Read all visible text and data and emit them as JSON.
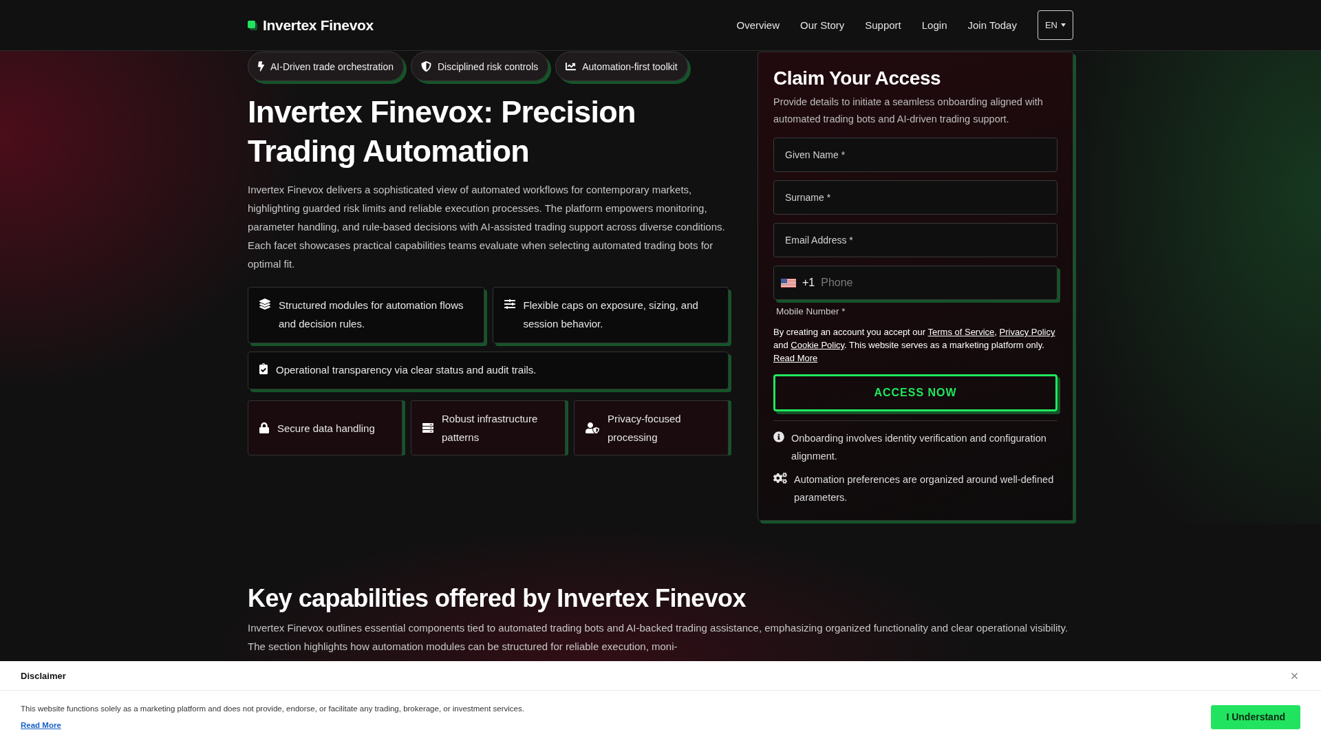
{
  "header": {
    "logo": "Invertex Finevox",
    "nav": [
      {
        "label": "Overview"
      },
      {
        "label": "Our Story"
      },
      {
        "label": "Support"
      },
      {
        "label": "Login"
      },
      {
        "label": "Join Today"
      }
    ],
    "language": "EN"
  },
  "hero": {
    "badges": [
      {
        "label": "AI-Driven trade orchestration"
      },
      {
        "label": "Disciplined risk controls"
      },
      {
        "label": "Automation-first toolkit"
      }
    ],
    "title": "Invertex Finevox: Precision Trading Automation",
    "description": "Invertex Finevox delivers a sophisticated view of automated workflows for contemporary markets, highlighting guarded risk limits and reliable execution processes. The platform empowers monitoring, parameter handling, and rule-based decisions with AI-assisted trading support across diverse conditions. Each facet showcases practical capabilities teams evaluate when selecting automated trading bots for optimal fit.",
    "features": [
      {
        "text": "Structured modules for automation flows and decision rules."
      },
      {
        "text": "Flexible caps on exposure, sizing, and session behavior."
      },
      {
        "text": "Operational transparency via clear status and audit trails."
      }
    ],
    "highlights": [
      {
        "text": "Secure data handling"
      },
      {
        "text": "Robust infrastructure patterns"
      },
      {
        "text": "Privacy-focused processing"
      }
    ]
  },
  "signup_form": {
    "title": "Claim Your Access",
    "description": "Provide details to initiate a seamless onboarding aligned with automated trading bots and AI-driven trading support.",
    "fields": [
      {
        "placeholder": "Given Name *"
      },
      {
        "placeholder": "Surname *"
      },
      {
        "placeholder": "Email Address *"
      }
    ],
    "phone": {
      "country_code": "+1",
      "placeholder": "Phone",
      "label": "Mobile Number *"
    },
    "consent": [
      {
        "kind": "text",
        "text": "By creating an account you accept our "
      },
      {
        "kind": "link",
        "text": "Terms of Service"
      },
      {
        "kind": "text",
        "text": ", "
      },
      {
        "kind": "link",
        "text": "Privacy Policy"
      },
      {
        "kind": "text",
        "text": " and "
      },
      {
        "kind": "link",
        "text": "Cookie Policy"
      },
      {
        "kind": "text",
        "text": ". This website serves as a marketing platform only. "
      },
      {
        "kind": "link",
        "text": "Read More"
      }
    ],
    "submit": "ACCESS NOW",
    "notes": [
      {
        "text": "Onboarding involves identity verification and configuration alignment."
      },
      {
        "text": "Automation preferences are organized around well-defined parameters."
      }
    ]
  },
  "capabilities": {
    "title": "Key capabilities offered by Invertex Finevox",
    "description": "Invertex Finevox outlines essential components tied to automated trading bots and AI-backed trading assistance, emphasizing organized functionality and clear operational visibility. The section highlights how automation modules can be structured for reliable execution, moni-"
  },
  "disclaimer": {
    "title": "Disclaimer",
    "text": "This website functions solely as a marketing platform and does not provide, endorse, or facilitate any trading, brokerage, or investment services.",
    "link": "Read More",
    "button": "I Understand"
  }
}
